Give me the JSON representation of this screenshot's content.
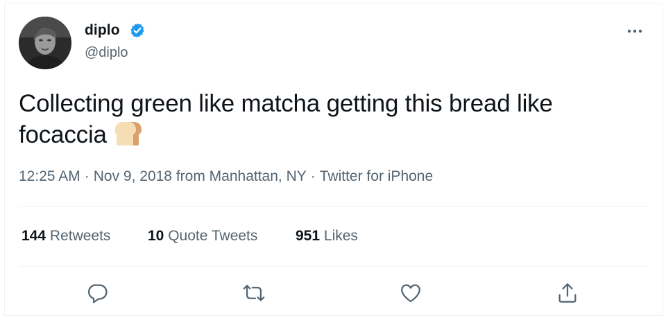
{
  "author": {
    "display_name": "diplo",
    "handle": "@diplo",
    "verified": true,
    "accent_color": "#1d9bf0"
  },
  "tweet": {
    "text_line1": "Collecting green like matcha getting this bread like",
    "text_line2": "focaccia",
    "emoji": "bread"
  },
  "meta": {
    "time": "12:25 AM",
    "date": "Nov 9, 2018",
    "location": "from Manhattan, NY",
    "source": "Twitter for iPhone",
    "separator": "·"
  },
  "stats": {
    "retweets": {
      "count": "144",
      "label": "Retweets"
    },
    "quotes": {
      "count": "10",
      "label": "Quote Tweets"
    },
    "likes": {
      "count": "951",
      "label": "Likes"
    }
  },
  "actions": [
    "reply-icon",
    "retweet-icon",
    "like-icon",
    "share-icon"
  ]
}
